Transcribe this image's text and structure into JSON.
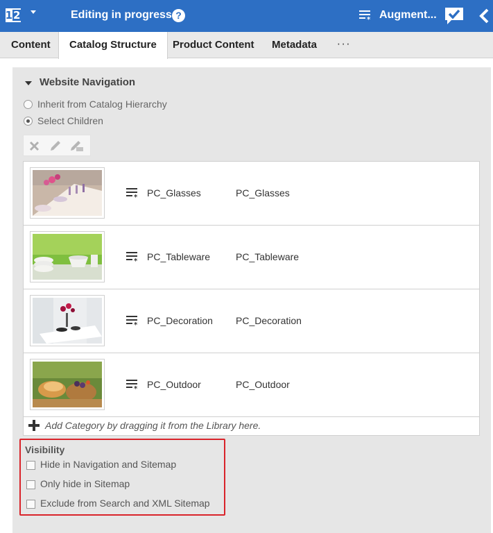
{
  "header": {
    "logo_digit_1": "1",
    "logo_digit_2": "2",
    "status": "Editing in progress",
    "augment_label": "Augment...",
    "colors": {
      "bar": "#2d6fc4",
      "text": "#ffffff"
    }
  },
  "tabs": [
    {
      "label": "Content",
      "active": false
    },
    {
      "label": "Catalog Structure",
      "active": true
    },
    {
      "label": "Product Content",
      "active": false
    },
    {
      "label": "Metadata",
      "active": false
    }
  ],
  "tabs_more": "···",
  "website_navigation": {
    "title": "Website Navigation",
    "options": [
      {
        "label": "Inherit from Catalog Hierarchy",
        "selected": false
      },
      {
        "label": "Select Children",
        "selected": true
      }
    ],
    "toolbar": [
      "delete-icon",
      "edit-icon",
      "clear-icon"
    ]
  },
  "categories": [
    {
      "name": "PC_Glasses",
      "id": "PC_Glasses",
      "image": "glasses-table-photo"
    },
    {
      "name": "PC_Tableware",
      "id": "PC_Tableware",
      "image": "tableware-photo"
    },
    {
      "name": "PC_Decoration",
      "id": "PC_Decoration",
      "image": "decoration-photo"
    },
    {
      "name": "PC_Outdoor",
      "id": "PC_Outdoor",
      "image": "outdoor-photo"
    }
  ],
  "add_hint": "Add Category by dragging it from the Library here.",
  "visibility": {
    "title": "Visibility",
    "options": [
      {
        "label": "Hide in Navigation and Sitemap",
        "checked": false
      },
      {
        "label": "Only hide in Sitemap",
        "checked": false
      },
      {
        "label": "Exclude from Search and XML Sitemap",
        "checked": false
      }
    ],
    "highlight_color": "#d9232a"
  }
}
